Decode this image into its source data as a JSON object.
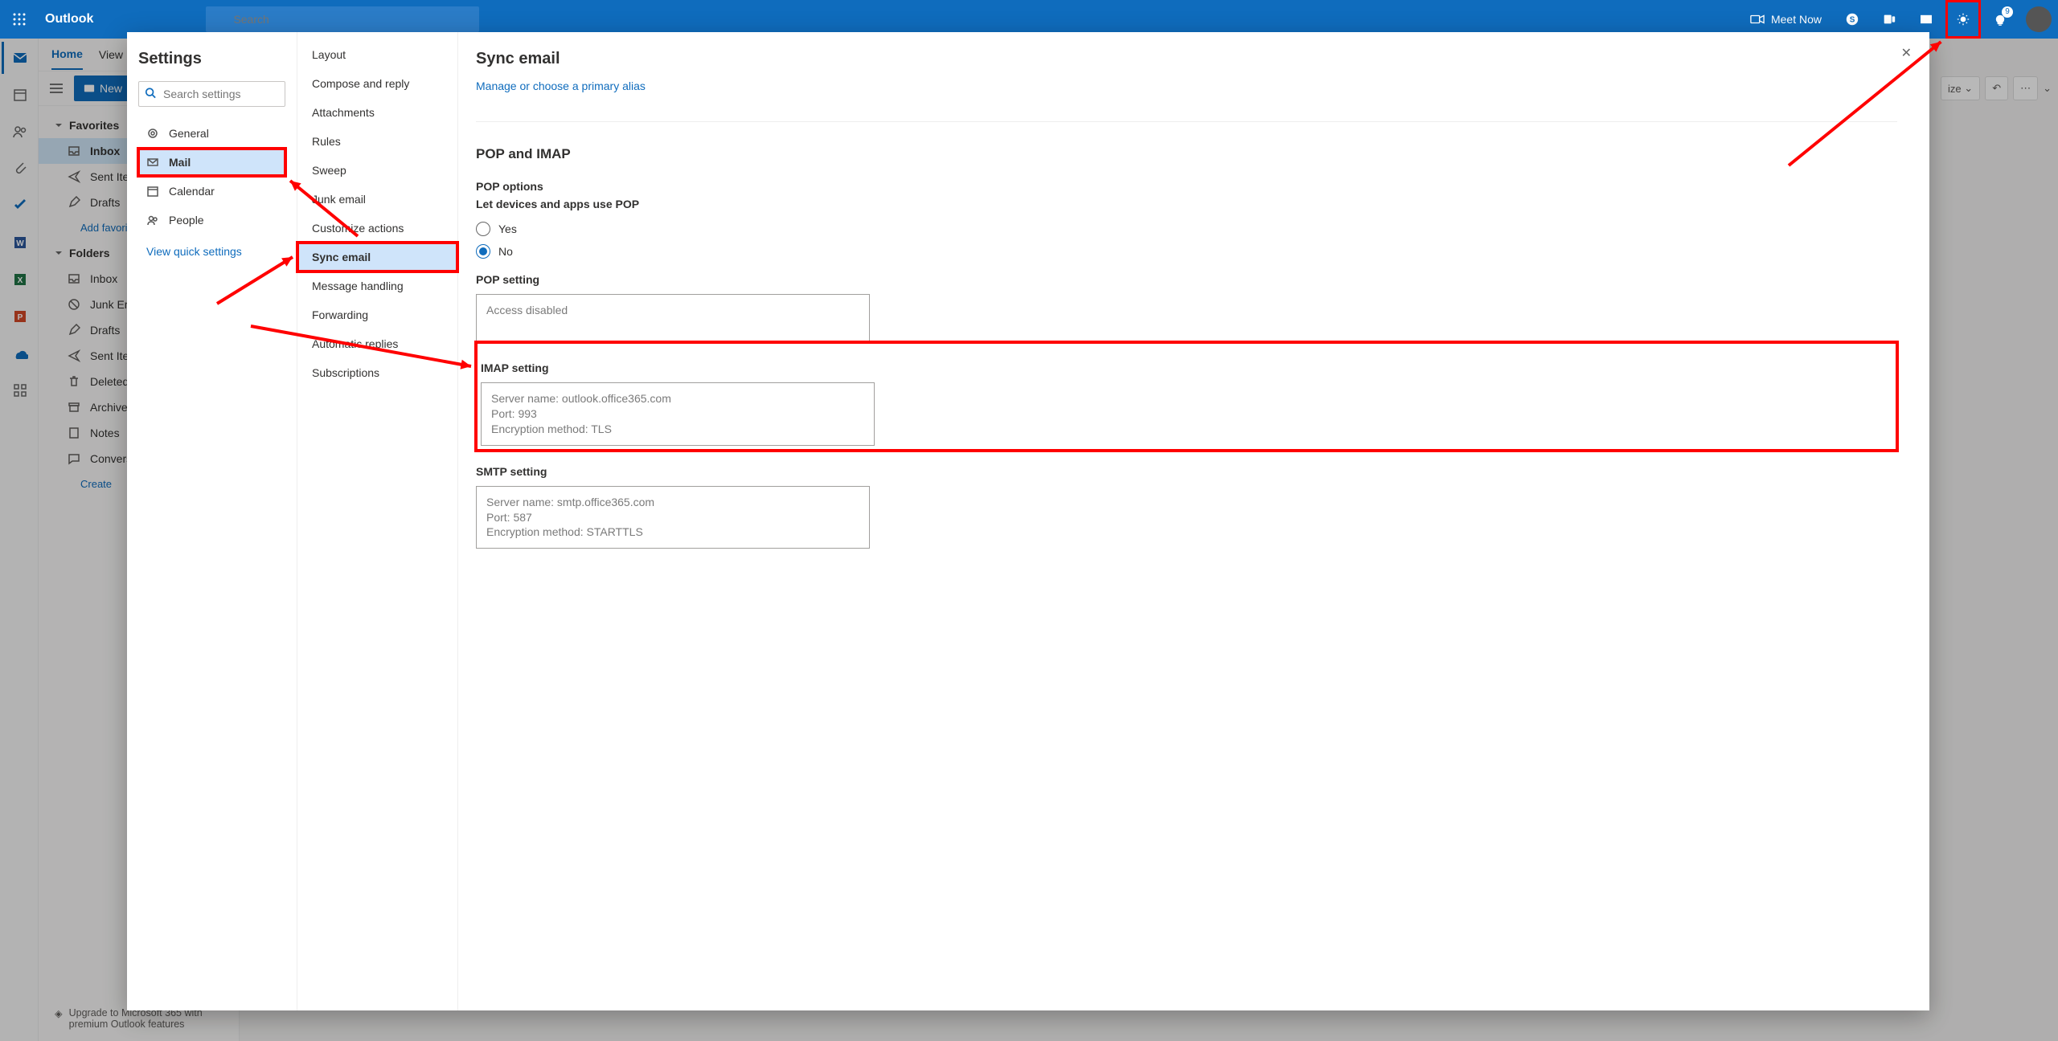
{
  "topbar": {
    "brand": "Outlook",
    "searchPlaceholder": "Search",
    "meetNow": "Meet Now",
    "notifCount": "9"
  },
  "ribbon": {
    "tabs": [
      "Home",
      "View"
    ],
    "newBtn": "New"
  },
  "nav": {
    "favorites": "Favorites",
    "favItems": [
      "Inbox",
      "Sent Items",
      "Drafts"
    ],
    "addFav": "Add favorite",
    "folders": "Folders",
    "folderItems": [
      "Inbox",
      "Junk Email",
      "Drafts",
      "Sent Items",
      "Deleted",
      "Archive",
      "Notes",
      "Conversations"
    ],
    "createLink": "Create"
  },
  "upgrade": "Upgrade to Microsoft 365 with premium Outlook features",
  "rightbar": {
    "undo": "↶",
    "more": "⋯",
    "size": "ize",
    "chev": "⌄"
  },
  "modal": {
    "title": "Settings",
    "searchPlaceholder": "Search settings",
    "cats": [
      "General",
      "Mail",
      "Calendar",
      "People"
    ],
    "vqs": "View quick settings",
    "subs": [
      "Layout",
      "Compose and reply",
      "Attachments",
      "Rules",
      "Sweep",
      "Junk email",
      "Customize actions",
      "Sync email",
      "Message handling",
      "Forwarding",
      "Automatic replies",
      "Subscriptions"
    ]
  },
  "page": {
    "title": "Sync email",
    "aliasLink": "Manage or choose a primary alias",
    "popImap": "POP and IMAP",
    "popOptions": "POP options",
    "letDevices": "Let devices and apps use POP",
    "yes": "Yes",
    "no": "No",
    "popSetting": "POP setting",
    "popBox": "Access disabled",
    "imapSetting": "IMAP setting",
    "imapL1": "Server name: outlook.office365.com",
    "imapL2": "Port: 993",
    "imapL3": "Encryption method: TLS",
    "smtpSetting": "SMTP setting",
    "smtpL1": "Server name: smtp.office365.com",
    "smtpL2": "Port: 587",
    "smtpL3": "Encryption method: STARTTLS"
  }
}
